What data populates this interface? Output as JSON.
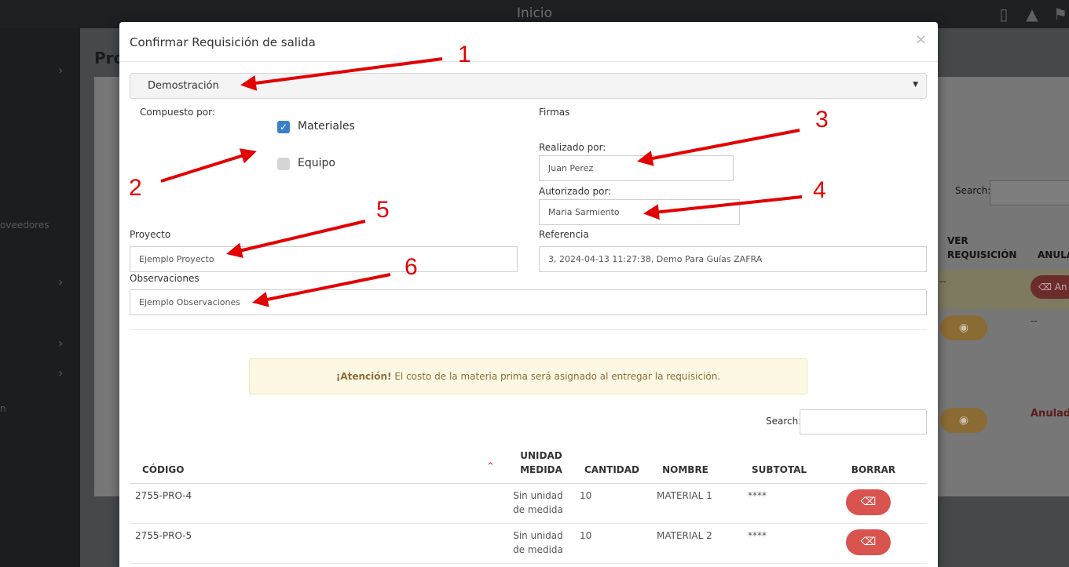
{
  "topbar": {
    "title": "Inicio"
  },
  "sidebar": {
    "label_proveedores": "oveedores",
    "label_n": "n"
  },
  "background": {
    "heading": "Pro",
    "search_label": "Search:",
    "col_ver": "VER REQUISICIÓN",
    "col_anular": "ANULA",
    "anular_btn": "An",
    "dash": "--",
    "anulada": "Anulada"
  },
  "modal": {
    "title": "Confirmar Requisición de salida",
    "close": "×",
    "select_value": "Demostración",
    "compuesto_label": "Compuesto por:",
    "materiales_label": "Materiales",
    "equipo_label": "Equipo",
    "firmas_label": "Firmas",
    "realizado_label": "Realizado por:",
    "realizado_value": "Juan Perez",
    "autorizado_label": "Autorizado por:",
    "autorizado_value": "Maria Sarmiento",
    "proyecto_label": "Proyecto",
    "proyecto_value": "Ejemplo Proyecto",
    "referencia_label": "Referencia",
    "referencia_value": "3, 2024-04-13 11:27:38, Demo Para Guías ZAFRA",
    "observaciones_label": "Observaciones",
    "observaciones_value": "Ejemplo Observaciones",
    "alert_strong": "¡Atención!",
    "alert_text": " El costo de la materia prima será asignado al entregar la requisición.",
    "search_label": "Search:"
  },
  "table": {
    "headers": {
      "codigo": "CÓDIGO",
      "unidad": "UNIDAD MEDIDA",
      "cantidad": "CANTIDAD",
      "nombre": "NOMBRE",
      "subtotal": "SUBTOTAL",
      "borrar": "BORRAR"
    },
    "rows": [
      {
        "codigo": "2755-PRO-4",
        "unidad": "Sin unidad de medida",
        "cantidad": "10",
        "nombre": "MATERIAL 1",
        "subtotal": "****"
      },
      {
        "codigo": "2755-PRO-5",
        "unidad": "Sin unidad de medida",
        "cantidad": "10",
        "nombre": "MATERIAL 2",
        "subtotal": "****"
      }
    ]
  },
  "annotations": [
    "1",
    "2",
    "3",
    "4",
    "5",
    "6"
  ],
  "colors": {
    "arrow": "#e30000",
    "primary_check": "#3a7fc9",
    "danger": "#d9534f",
    "alert_bg": "#fcf8e3"
  }
}
